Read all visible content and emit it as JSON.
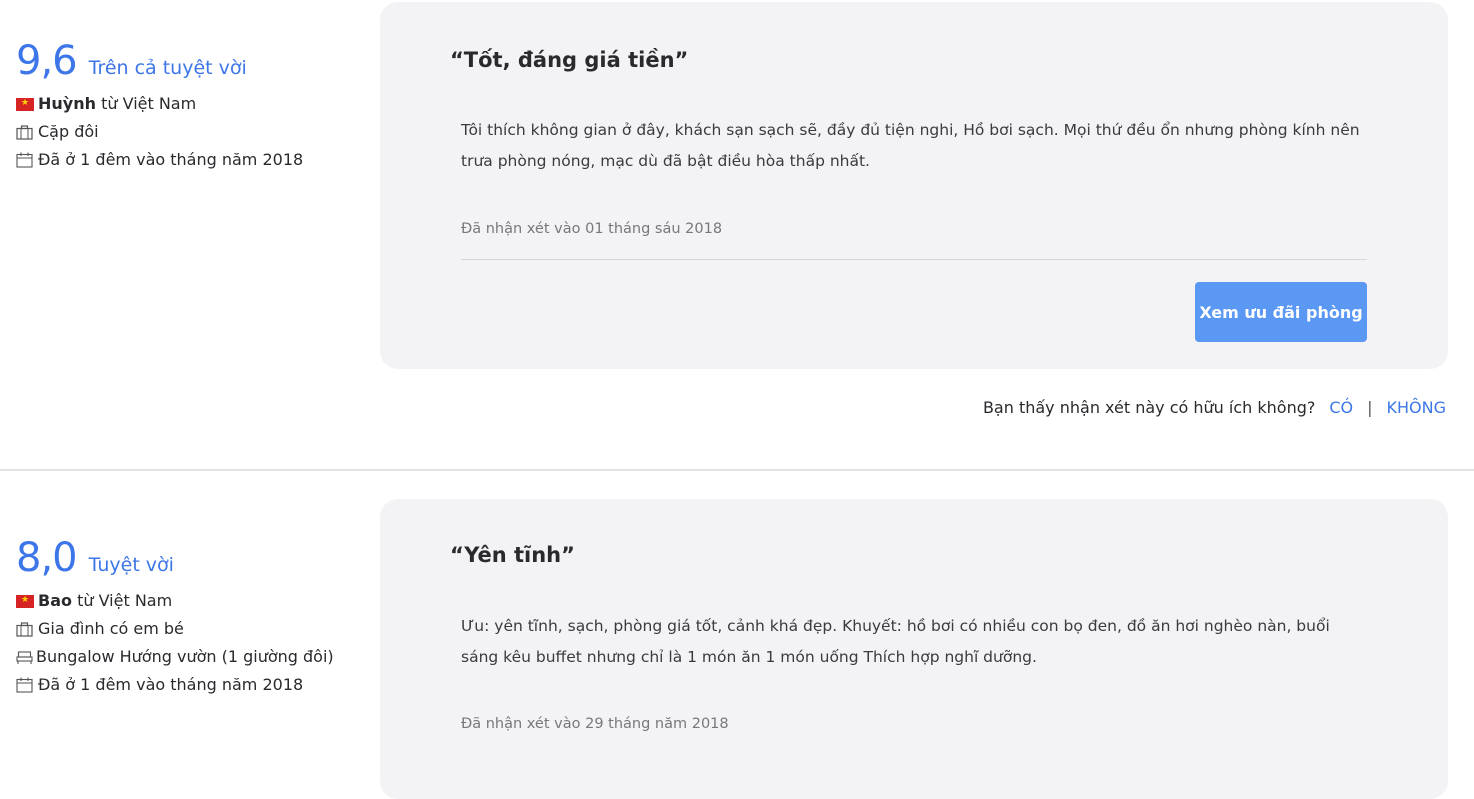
{
  "reviews": [
    {
      "score": "9,6",
      "score_label": "Trên cả tuyệt vời",
      "reviewer_name": "Huỳnh",
      "reviewer_origin": "từ Việt Nam",
      "traveler_type": "Cặp đôi",
      "room_type": "",
      "stay": "Đã ở 1 đêm vào tháng năm 2018",
      "title": "“Tốt, đáng giá tiền”",
      "text": "Tôi thích không gian ở đây, khách sạn sạch sẽ, đầy đủ tiện nghi, Hồ bơi sạch. Mọi thứ đều ổn nhưng phòng kính nên trưa phòng nóng, mạc dù đã bật điều hòa thấp nhất.",
      "review_date": "Đã nhận xét vào 01 tháng sáu 2018",
      "cta_label": "Xem ưu đãi phòng",
      "helpful_question": "Bạn thấy nhận xét này có hữu ích không?",
      "helpful_yes": "CÓ",
      "helpful_separator": "|",
      "helpful_no": "KHÔNG"
    },
    {
      "score": "8,0",
      "score_label": "Tuyệt vời",
      "reviewer_name": "Bao",
      "reviewer_origin": "từ Việt Nam",
      "traveler_type": "Gia đình có em bé",
      "room_type": "Bungalow Hướng vườn (1 giường đôi)",
      "stay": "Đã ở 1 đêm vào tháng năm 2018",
      "title": "“Yên tĩnh”",
      "text": "Ưu: yên tĩnh, sạch, phòng giá tốt, cảnh khá đẹp. Khuyết: hồ bơi có nhiều con bọ đen, đồ ăn hơi nghèo nàn, buổi sáng kêu buffet nhưng chỉ là 1 món ăn 1 món uống Thích hợp nghĩ dưỡng.",
      "review_date": "Đã nhận xét vào 29 tháng năm 2018"
    }
  ],
  "colors": {
    "accent": "#3c76e8",
    "button": "#5b98f4",
    "card_bg": "#f3f3f5",
    "flag_red": "#d62323",
    "flag_star": "#ffd400"
  },
  "icons": {
    "flag": "vietnam-flag-icon",
    "traveler": "briefcase-icon",
    "room": "bed-icon",
    "stay": "calendar-icon"
  }
}
